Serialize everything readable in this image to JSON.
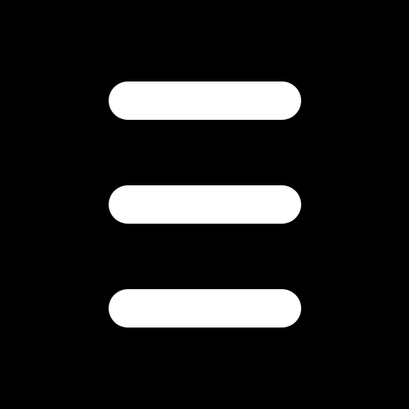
{
  "app": {
    "icon": "hamburger-menu-icon",
    "background_color": "#000000",
    "foreground_color": "#ffffff",
    "line_count": 3
  }
}
